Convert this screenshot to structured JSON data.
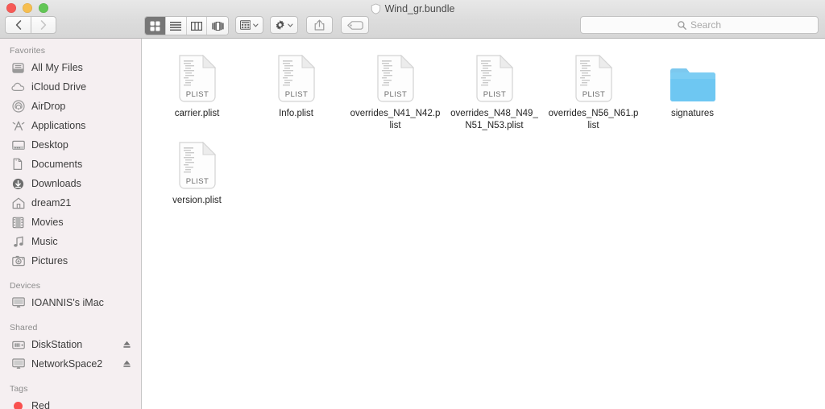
{
  "window": {
    "title": "Wind_gr.bundle",
    "title_icon": "bundle-shield-icon",
    "traffic_lights": [
      {
        "name": "close-button",
        "color": "#f65a56"
      },
      {
        "name": "minimize-button",
        "color": "#f6be4f"
      },
      {
        "name": "zoom-button",
        "color": "#62c655"
      }
    ]
  },
  "toolbar": {
    "back_label": "‹",
    "forward_label": "›",
    "view_buttons": [
      {
        "name": "icon-view-button",
        "icon": "grid-icon",
        "active": true
      },
      {
        "name": "list-view-button",
        "icon": "list-icon",
        "active": false
      },
      {
        "name": "column-view-button",
        "icon": "columns-icon",
        "active": false
      },
      {
        "name": "gallery-view-button",
        "icon": "coverflow-icon",
        "active": false
      }
    ],
    "arrange_button": {
      "name": "arrange-button",
      "icon": "arrange-grid-icon"
    },
    "action_button": {
      "name": "action-button",
      "icon": "gear-icon"
    },
    "share_button": {
      "name": "share-button",
      "icon": "share-icon"
    },
    "tag_button": {
      "name": "tag-button",
      "icon": "tag-icon"
    }
  },
  "search": {
    "placeholder": "Search",
    "value": "",
    "icon": "search-icon"
  },
  "sidebar": {
    "sections": [
      {
        "title": "Favorites",
        "items": [
          {
            "label": "All My Files",
            "icon": "all-my-files-icon"
          },
          {
            "label": "iCloud Drive",
            "icon": "cloud-icon"
          },
          {
            "label": "AirDrop",
            "icon": "airdrop-icon"
          },
          {
            "label": "Applications",
            "icon": "applications-icon"
          },
          {
            "label": "Desktop",
            "icon": "desktop-icon"
          },
          {
            "label": "Documents",
            "icon": "documents-icon"
          },
          {
            "label": "Downloads",
            "icon": "downloads-icon"
          },
          {
            "label": "dream21",
            "icon": "home-icon"
          },
          {
            "label": "Movies",
            "icon": "movies-icon"
          },
          {
            "label": "Music",
            "icon": "music-icon"
          },
          {
            "label": "Pictures",
            "icon": "pictures-icon"
          }
        ]
      },
      {
        "title": "Devices",
        "items": [
          {
            "label": "IOANNIS's iMac",
            "icon": "imac-icon"
          }
        ]
      },
      {
        "title": "Shared",
        "items": [
          {
            "label": "DiskStation",
            "icon": "server-icon",
            "eject": true
          },
          {
            "label": "NetworkSpace2",
            "icon": "display-icon",
            "eject": true
          }
        ]
      },
      {
        "title": "Tags",
        "items": [
          {
            "label": "Red",
            "icon": "tag-dot-icon",
            "color": "#f9504e"
          }
        ]
      }
    ]
  },
  "files": [
    {
      "name": "carrier.plist",
      "kind": "plist",
      "badge": "PLIST"
    },
    {
      "name": "Info.plist",
      "kind": "plist",
      "badge": "PLIST"
    },
    {
      "name": "overrides_N41_N42.plist",
      "kind": "plist",
      "badge": "PLIST"
    },
    {
      "name": "overrides_N48_N49_N51_N53.plist",
      "kind": "plist",
      "badge": "PLIST"
    },
    {
      "name": "overrides_N56_N61.plist",
      "kind": "plist",
      "badge": "PLIST"
    },
    {
      "name": "signatures",
      "kind": "folder",
      "badge": ""
    },
    {
      "name": "version.plist",
      "kind": "plist",
      "badge": "PLIST"
    }
  ],
  "colors": {
    "folder": "#6ec7f2",
    "sidebar_bg": "#f5eff1",
    "titlebar_bg": "#dcdcdc",
    "tag_red": "#f9504e"
  }
}
